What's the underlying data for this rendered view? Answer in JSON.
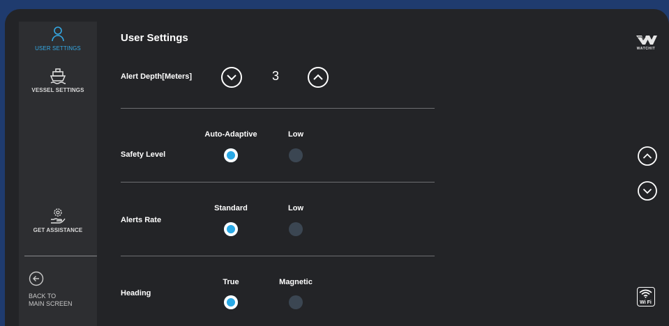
{
  "sidebar": {
    "user_settings": "USER SETTINGS",
    "vessel_settings": "VESSEL SETTINGS",
    "get_assistance": "GET ASSISTANCE",
    "back_line1": "BACK TO",
    "back_line2": "MAIN SCREEN"
  },
  "main": {
    "title": "User Settings",
    "alert_depth": {
      "label": "Alert Depth[Meters]",
      "value": "3"
    },
    "safety_level": {
      "label": "Safety Level",
      "options": [
        "Auto-Adaptive",
        "Low"
      ],
      "selected": "Auto-Adaptive"
    },
    "alerts_rate": {
      "label": "Alerts Rate",
      "options": [
        "Standard",
        "Low"
      ],
      "selected": "Standard"
    },
    "heading": {
      "label": "Heading",
      "options": [
        "True",
        "Magnetic"
      ],
      "selected": "True"
    }
  },
  "brand": {
    "logo_text": "WATCHIT"
  },
  "status": {
    "wifi_label": "Wi Fi"
  },
  "colors": {
    "accent": "#29a9e6",
    "background": "#232427",
    "sidebar": "#2d2e31",
    "outer_frame": "#1f3b6e",
    "radio_off": "#3b4652"
  },
  "icons": {
    "user": "user-icon",
    "vessel": "ship-icon",
    "assistance": "hand-gear-icon",
    "back": "arrow-left-circle-icon",
    "decrease": "chevron-down-circle-icon",
    "increase": "chevron-up-circle-icon",
    "scroll_up": "chevron-up-circle-icon",
    "scroll_down": "chevron-down-circle-icon",
    "wifi": "wifi-icon",
    "logo": "watchit-logo"
  }
}
